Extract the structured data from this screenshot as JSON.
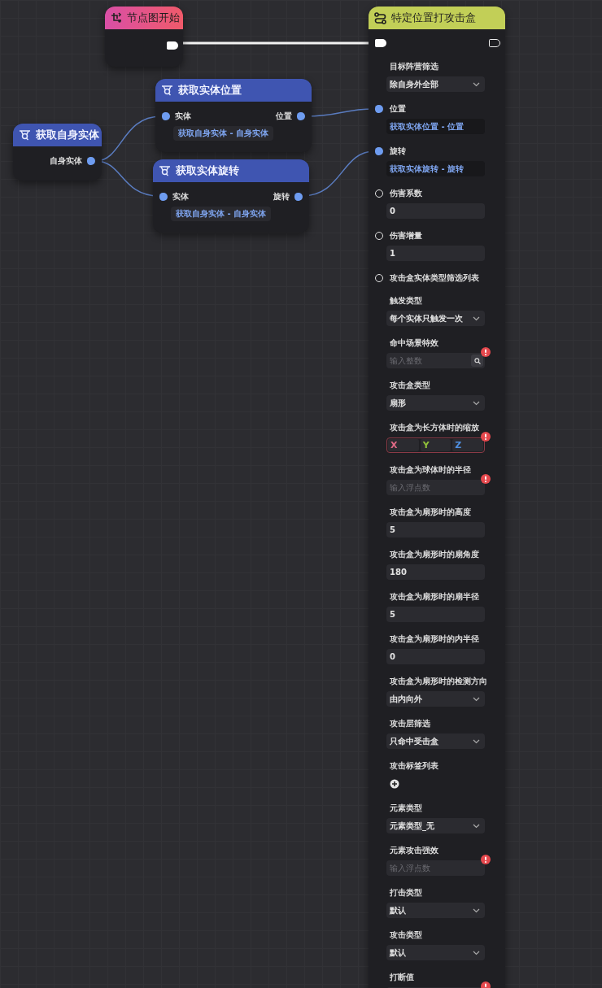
{
  "nodes": [
    {
      "kind": "start",
      "title": "节点图开始",
      "exec_out": {
        "connected": true
      }
    },
    {
      "kind": "query",
      "title": "获取自身实体",
      "outputs": [
        {
          "label": "自身实体",
          "connected": true
        }
      ]
    },
    {
      "kind": "query",
      "title": "获取实体位置",
      "inputs": [
        {
          "label": "实体",
          "connected": true,
          "source": "获取自身实体 - 自身实体"
        }
      ],
      "outputs": [
        {
          "label": "位置",
          "connected": true
        }
      ]
    },
    {
      "kind": "query",
      "title": "获取实体旋转",
      "inputs": [
        {
          "label": "实体",
          "connected": true,
          "source": "获取自身实体 - 自身实体"
        }
      ],
      "outputs": [
        {
          "label": "旋转",
          "connected": true
        }
      ]
    },
    {
      "kind": "action",
      "title": "特定位置打攻击盒",
      "exec_in": {
        "connected": true
      },
      "exec_out": {
        "connected": false
      },
      "rows": [
        {
          "label": "目标阵营筛选",
          "kind": "select",
          "value": "除自身外全部"
        },
        {
          "label": "位置",
          "connected": true,
          "kind": "ref",
          "value": "获取实体位置 - 位置"
        },
        {
          "label": "旋转",
          "connected": true,
          "kind": "ref",
          "value": "获取实体旋转 - 旋转"
        },
        {
          "label": "伤害系数",
          "connected": false,
          "kind": "number",
          "value": "0"
        },
        {
          "label": "伤害增量",
          "connected": false,
          "kind": "number",
          "value": "1"
        },
        {
          "label": "攻击盒实体类型筛选列表",
          "connected": false,
          "kind": "list"
        },
        {
          "label": "触发类型",
          "kind": "select",
          "value": "每个实体只触发一次"
        },
        {
          "label": "命中场景特效",
          "kind": "search",
          "placeholder": "输入整数",
          "error": true
        },
        {
          "label": "攻击盒类型",
          "kind": "select",
          "value": "扇形"
        },
        {
          "label": "攻击盒为长方体时的缩放",
          "kind": "vector",
          "error": true,
          "axes": [
            {
              "label": "X",
              "color": "#e06a86"
            },
            {
              "label": "Y",
              "color": "#8fbf3a"
            },
            {
              "label": "Z",
              "color": "#4f8fe0"
            }
          ]
        },
        {
          "label": "攻击盒为球体时的半径",
          "kind": "number",
          "placeholder": "输入浮点数",
          "error": true
        },
        {
          "label": "攻击盒为扇形时的高度",
          "kind": "number",
          "value": "5"
        },
        {
          "label": "攻击盒为扇形时的扇角度",
          "kind": "number",
          "value": "180"
        },
        {
          "label": "攻击盒为扇形时的扇半径",
          "kind": "number",
          "value": "5"
        },
        {
          "label": "攻击盒为扇形时的内半径",
          "kind": "number",
          "value": "0"
        },
        {
          "label": "攻击盒为扇形时的检测方向",
          "kind": "select",
          "value": "由内向外"
        },
        {
          "label": "攻击层筛选",
          "kind": "select",
          "value": "只命中受击盒"
        },
        {
          "label": "攻击标签列表",
          "kind": "add"
        },
        {
          "label": "元素类型",
          "kind": "select",
          "value": "元素类型_无"
        },
        {
          "label": "元素攻击强效",
          "kind": "number",
          "placeholder": "输入浮点数",
          "error": true
        },
        {
          "label": "打击类型",
          "kind": "select",
          "value": "默认"
        },
        {
          "label": "攻击类型",
          "kind": "select",
          "value": "默认"
        },
        {
          "label": "打断值",
          "kind": "number",
          "error": true
        }
      ]
    }
  ]
}
